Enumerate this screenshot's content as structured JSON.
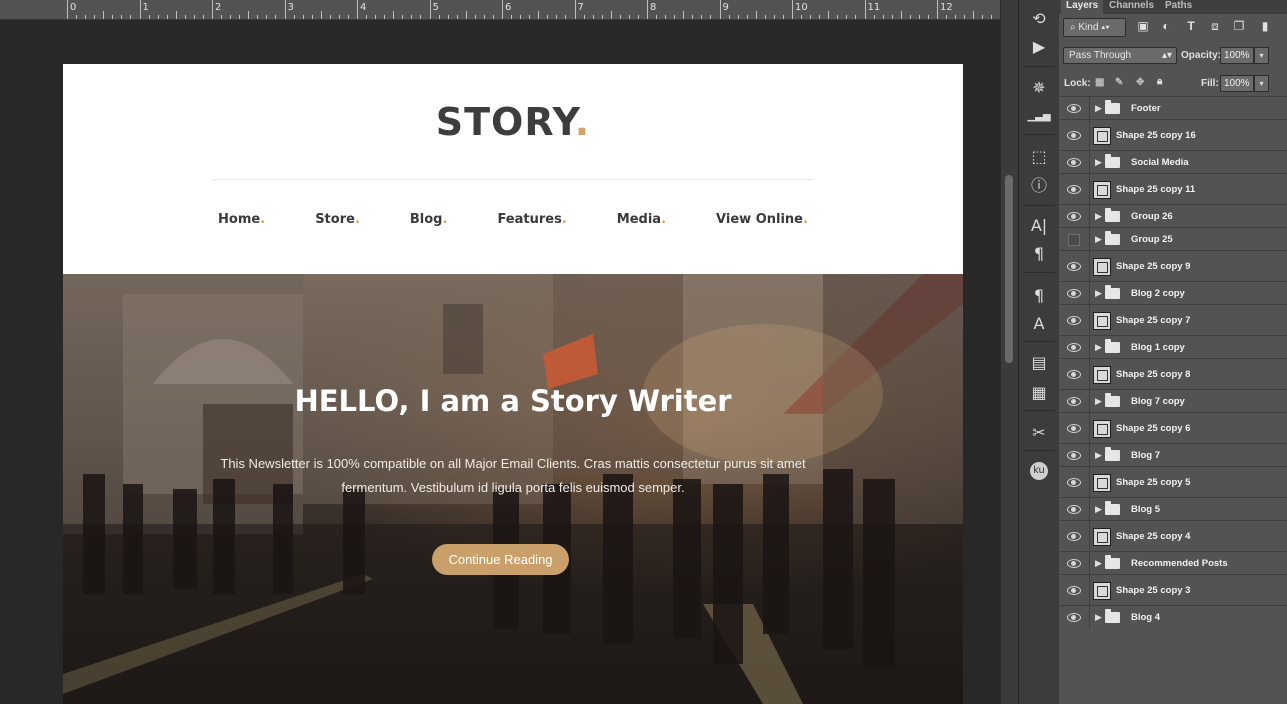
{
  "ruler": {
    "labels": [
      "0",
      "1",
      "2",
      "3",
      "4",
      "5",
      "6",
      "7",
      "8",
      "9",
      "10",
      "11",
      "12"
    ]
  },
  "document": {
    "logo_text": "STORY",
    "logo_dot": ".",
    "accent_color": "#d3a266",
    "nav": [
      {
        "label": "Home",
        "dot": "."
      },
      {
        "label": "Store",
        "dot": "."
      },
      {
        "label": "Blog",
        "dot": "."
      },
      {
        "label": "Features",
        "dot": "."
      },
      {
        "label": "Media",
        "dot": "."
      },
      {
        "label": "View Online",
        "dot": "."
      }
    ],
    "hero": {
      "title": "HELLO, I am a Story Writer",
      "body_line1": "This Newsletter is 100% compatible on all Major Email Clients. Cras mattis consectetur purus sit amet",
      "body_line2": "fermentum. Vestibulum id ligula porta felis euismod semper.",
      "cta_label": "Continue Reading"
    }
  },
  "panel": {
    "tabs": [
      "Layers",
      "Channels",
      "Paths"
    ],
    "filter_kind": "Kind",
    "blend_mode": "Pass Through",
    "opacity_label": "Opacity:",
    "opacity_value": "100%",
    "lock_label": "Lock:",
    "fill_label": "Fill:",
    "fill_value": "100%",
    "layers": [
      {
        "name": "Footer",
        "type": "group",
        "visible": true
      },
      {
        "name": "Shape 25 copy 16",
        "type": "shape",
        "visible": true
      },
      {
        "name": "Social Media",
        "type": "group",
        "visible": true
      },
      {
        "name": "Shape 25 copy 11",
        "type": "shape",
        "visible": true
      },
      {
        "name": "Group 26",
        "type": "group",
        "visible": true
      },
      {
        "name": "Group 25",
        "type": "group",
        "visible": false
      },
      {
        "name": "Shape 25 copy 9",
        "type": "shape",
        "visible": true
      },
      {
        "name": "Blog 2 copy",
        "type": "group",
        "visible": true
      },
      {
        "name": "Shape 25 copy 7",
        "type": "shape",
        "visible": true
      },
      {
        "name": "Blog 1 copy",
        "type": "group",
        "visible": true
      },
      {
        "name": "Shape 25 copy 8",
        "type": "shape",
        "visible": true
      },
      {
        "name": "Blog 7 copy",
        "type": "group",
        "visible": true
      },
      {
        "name": "Shape 25 copy 6",
        "type": "shape",
        "visible": true
      },
      {
        "name": "Blog 7",
        "type": "group",
        "visible": true
      },
      {
        "name": "Shape 25 copy 5",
        "type": "shape",
        "visible": true
      },
      {
        "name": "Blog 5",
        "type": "group",
        "visible": true
      },
      {
        "name": "Shape 25 copy 4",
        "type": "shape",
        "visible": true
      },
      {
        "name": "Recommended Posts",
        "type": "group",
        "visible": true
      },
      {
        "name": "Shape 25 copy 3",
        "type": "shape",
        "visible": true
      },
      {
        "name": "Blog 4",
        "type": "group",
        "visible": true
      }
    ]
  },
  "tools": [
    "history-icon",
    "play-icon",
    "color-wheel-icon",
    "levels-icon",
    "cube-icon",
    "info-icon",
    "character-icon",
    "paragraph-icon",
    "paragraph-style-icon",
    "character-style-icon",
    "book-icon",
    "notes-icon",
    "tools-icon",
    "kuler-icon"
  ]
}
